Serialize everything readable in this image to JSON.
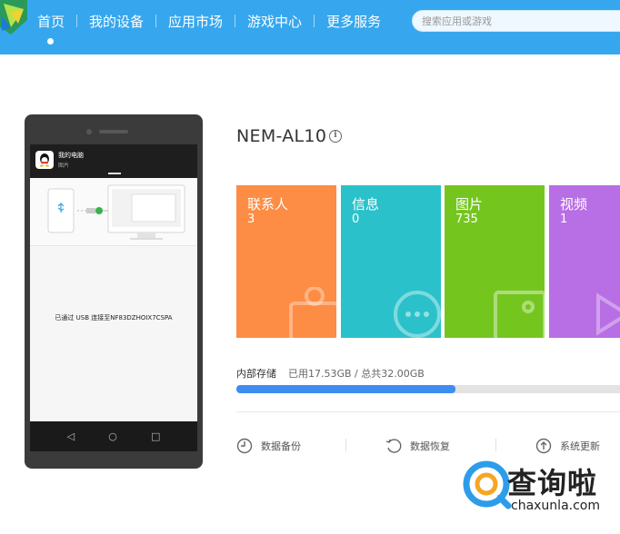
{
  "nav": {
    "items": [
      "首页",
      "我的设备",
      "应用市场",
      "游戏中心",
      "更多服务"
    ],
    "search_placeholder": "搜索应用或游戏"
  },
  "phone": {
    "app_title": "我的电脑",
    "app_subtitle": "图片",
    "message": "已通过 USB 连接至NF83DZHOIX7CSPA"
  },
  "device": {
    "name": "NEM-AL10"
  },
  "tiles": [
    {
      "label": "联系人",
      "count": "3",
      "color": "#fd8c44"
    },
    {
      "label": "信息",
      "count": "0",
      "color": "#2bc1ca"
    },
    {
      "label": "图片",
      "count": "735",
      "color": "#74c61f"
    },
    {
      "label": "视频",
      "count": "1",
      "color": "#b86ee4"
    }
  ],
  "storage": {
    "label": "内部存储",
    "detail": "已用17.53GB / 总共32.00GB",
    "used_fraction": 0.548
  },
  "actions": {
    "backup": "数据备份",
    "restore": "数据恢复",
    "update": "系统更新"
  },
  "watermark": {
    "text": "查询啦",
    "url": "chaxunla.com"
  },
  "colors": {
    "topbar": "#36a7ee",
    "progress": "#3d8df0"
  }
}
